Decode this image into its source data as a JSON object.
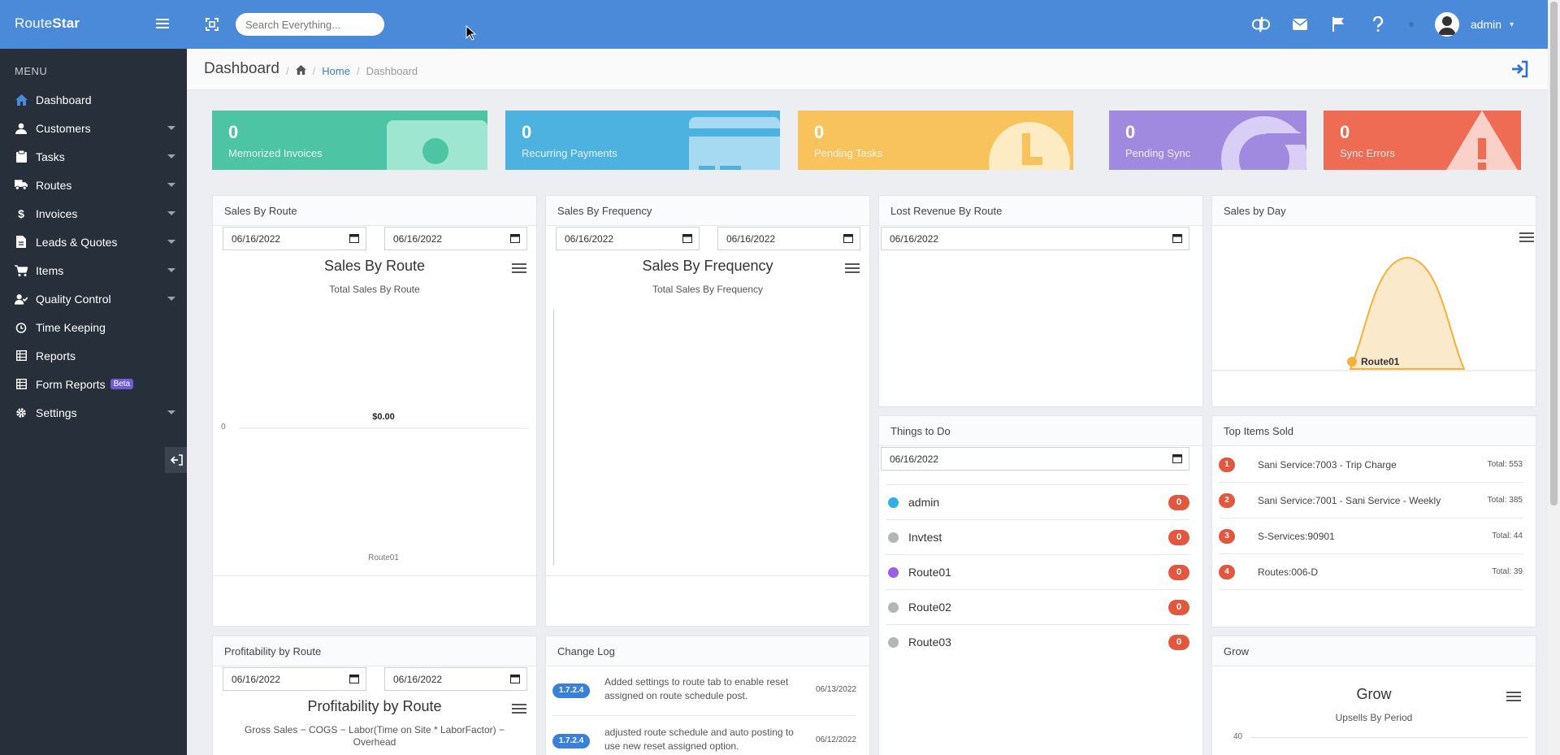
{
  "app": {
    "brand_light": "Route",
    "brand_bold": "Star"
  },
  "search": {
    "placeholder": "Search Everything..."
  },
  "user": {
    "name": "admin"
  },
  "sidebar": {
    "menu_label": "MENU",
    "items": [
      {
        "label": "Dashboard",
        "icon": "home-icon",
        "active": true
      },
      {
        "label": "Customers",
        "icon": "user-icon"
      },
      {
        "label": "Tasks",
        "icon": "clipboard-icon"
      },
      {
        "label": "Routes",
        "icon": "truck-icon"
      },
      {
        "label": "Invoices",
        "icon": "dollar-icon"
      },
      {
        "label": "Leads & Quotes",
        "icon": "document-icon"
      },
      {
        "label": "Items",
        "icon": "cart-icon"
      },
      {
        "label": "Quality Control",
        "icon": "user-check-icon"
      },
      {
        "label": "Time Keeping",
        "icon": "clock-icon"
      },
      {
        "label": "Reports",
        "icon": "table-icon"
      },
      {
        "label": "Form Reports",
        "icon": "table-icon",
        "badge": "Beta"
      },
      {
        "label": "Settings",
        "icon": "gear-icon"
      }
    ]
  },
  "header": {
    "title": "Dashboard",
    "crumb_home": "Home",
    "crumb_current": "Dashboard"
  },
  "stats": [
    {
      "value": "0",
      "label": "Memorized Invoices",
      "color": "#4dc4a4"
    },
    {
      "value": "0",
      "label": "Recurring Payments",
      "color": "#4db2e0"
    },
    {
      "value": "0",
      "label": "Pending Tasks",
      "color": "#f8c35c"
    },
    {
      "value": "0",
      "label": "Pending Sync",
      "color": "#a08ae0"
    },
    {
      "value": "0",
      "label": "Sync Errors",
      "color": "#ee6b54"
    }
  ],
  "panels": {
    "sales_route": {
      "title": "Sales By Route",
      "date_from": "06/16/2022",
      "date_to": "06/16/2022",
      "chart_title": "Sales By Route",
      "chart_sub": "Total Sales By Route"
    },
    "sales_freq": {
      "title": "Sales By Frequency",
      "date_from": "06/16/2022",
      "date_to": "06/16/2022",
      "chart_title": "Sales By Frequency",
      "chart_sub": "Total Sales By Frequency"
    },
    "lost_rev": {
      "title": "Lost Revenue By Route",
      "date": "06/16/2022"
    },
    "sales_day": {
      "title": "Sales by Day"
    },
    "todo": {
      "title": "Things to Do",
      "date": "06/16/2022",
      "rows": [
        {
          "name": "admin",
          "count": "0",
          "color": "#2fb0e6"
        },
        {
          "name": "Invtest",
          "count": "0",
          "color": "#b5b5b5"
        },
        {
          "name": "Route01",
          "count": "0",
          "color": "#9b5fe0"
        },
        {
          "name": "Route02",
          "count": "0",
          "color": "#b5b5b5"
        },
        {
          "name": "Route03",
          "count": "0",
          "color": "#b5b5b5"
        }
      ]
    },
    "top_items": {
      "title": "Top Items Sold",
      "rows": [
        {
          "rank": "1",
          "name": "Sani Service:7003 - Trip Charge",
          "total": "Total: 553"
        },
        {
          "rank": "2",
          "name": "Sani Service:7001 - Sani Service - Weekly",
          "total": "Total: 385"
        },
        {
          "rank": "3",
          "name": "S-Services:90901",
          "total": "Total: 44"
        },
        {
          "rank": "4",
          "name": "Routes:006-D",
          "total": "Total: 39"
        }
      ]
    },
    "profit": {
      "title": "Profitability by Route",
      "date_from": "06/16/2022",
      "date_to": "06/16/2022",
      "chart_title": "Profitability by Route",
      "chart_sub": "Gross Sales − COGS − Labor(Time on Site * LaborFactor) − Overhead"
    },
    "changelog": {
      "title": "Change Log",
      "rows": [
        {
          "version": "1.7.2.4",
          "text": "Added settings to route tab to enable reset assigned on route schedule post.",
          "date": "06/13/2022"
        },
        {
          "version": "1.7.2.4",
          "text": "adjusted route schedule and auto posting to use new reset assigned option.",
          "date": "06/12/2022"
        }
      ]
    },
    "grow": {
      "title": "Grow",
      "chart_title": "Grow",
      "chart_sub": "Upsells By Period"
    }
  },
  "chart_data": [
    {
      "type": "bar",
      "title": "Sales By Route",
      "subtitle": "Total Sales By Route",
      "categories": [
        "Route01"
      ],
      "values": [
        0
      ],
      "data_labels": [
        "$0.00"
      ],
      "y_tick_labels": [
        "0"
      ]
    },
    {
      "type": "bar",
      "title": "Sales By Frequency",
      "subtitle": "Total Sales By Frequency",
      "categories": [],
      "values": []
    },
    {
      "type": "area",
      "title": "",
      "series": [
        {
          "name": "Route01",
          "color": "#f3b13a"
        }
      ]
    },
    {
      "type": "line",
      "title": "Grow",
      "subtitle": "Upsells By Period",
      "y_tick_labels": [
        "40"
      ]
    }
  ]
}
